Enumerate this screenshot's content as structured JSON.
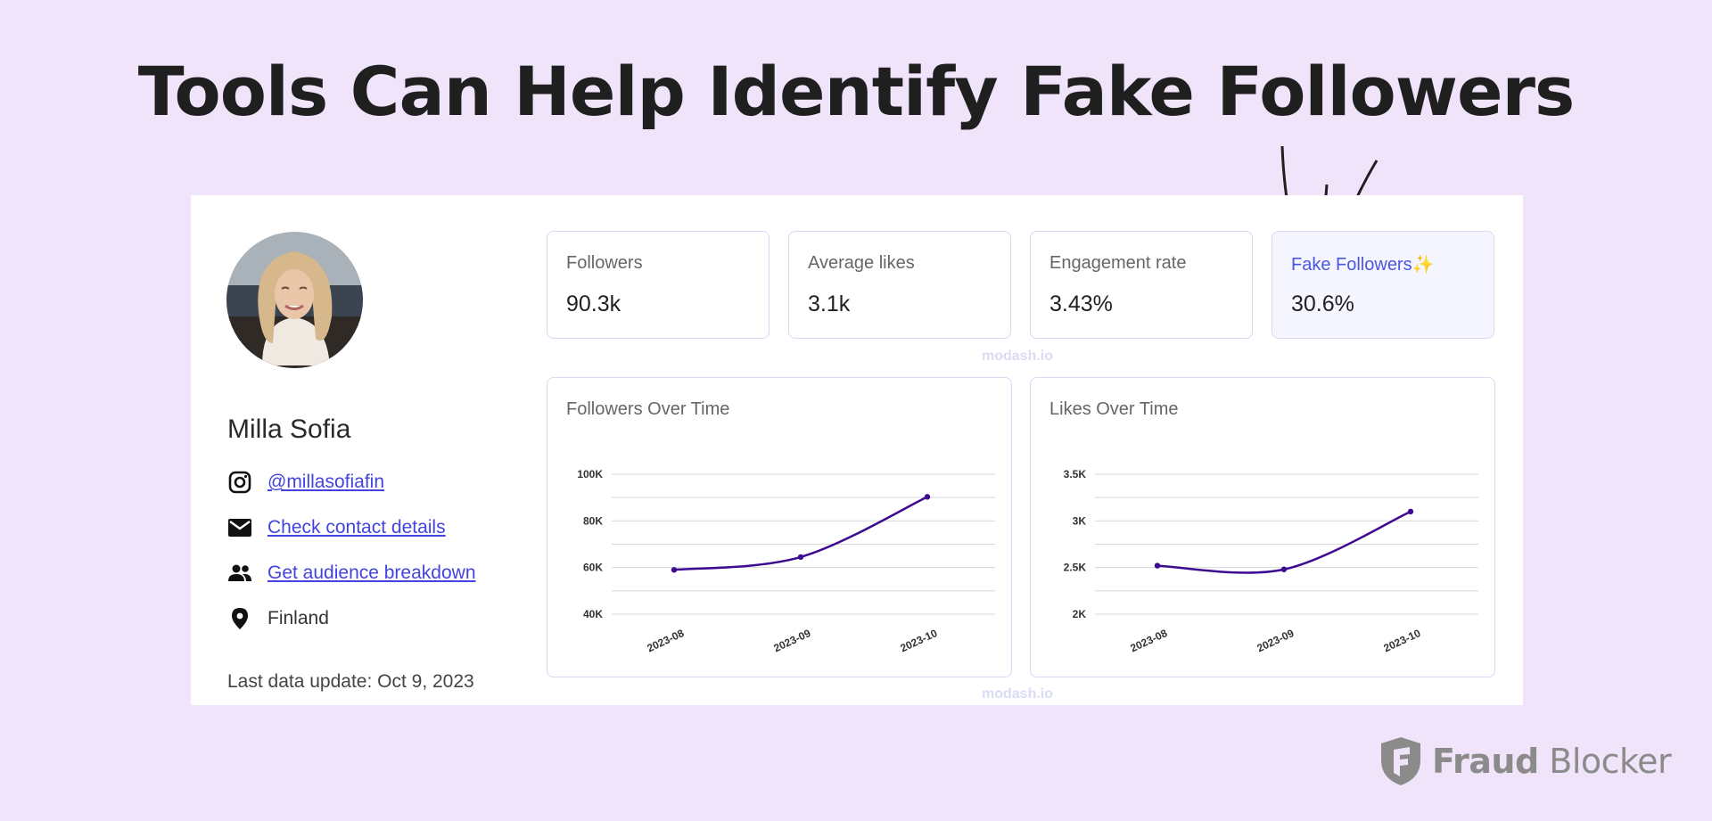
{
  "headline": "Tools Can Help Identify Fake Followers",
  "profile": {
    "name": "Milla Sofia",
    "instagram_handle": "@millasofiafin",
    "contact_link": "Check contact details",
    "audience_link": "Get audience breakdown",
    "location": "Finland",
    "last_update": "Last data update: Oct 9, 2023"
  },
  "stats": [
    {
      "label": "Followers",
      "value": "90.3k"
    },
    {
      "label": "Average likes",
      "value": "3.1k"
    },
    {
      "label": "Engagement rate",
      "value": "3.43%"
    },
    {
      "label": "Fake Followers",
      "value": "30.6%",
      "badge": "✨"
    }
  ],
  "watermark": "modash.io",
  "brand": {
    "word1": "Fraud",
    "word2": " Blocker"
  },
  "colors": {
    "background": "#f0e4fa",
    "accent": "#4343e0",
    "line": "#3d0a91",
    "card_border": "#d9d9f4"
  },
  "icons": [
    "instagram-icon",
    "mail-icon",
    "people-icon",
    "location-pin-icon",
    "shield-f-icon",
    "sparkles-icon"
  ],
  "chart_data": [
    {
      "type": "line",
      "title": "Followers Over Time",
      "categories": [
        "2023-08",
        "2023-09",
        "2023-10"
      ],
      "values": [
        59000,
        64500,
        90300
      ],
      "y_ticks": [
        40000,
        60000,
        80000,
        100000
      ],
      "y_tick_labels": [
        "40K",
        "60K",
        "80K",
        "100K"
      ],
      "ylim": [
        40000,
        100000
      ],
      "grid": true
    },
    {
      "type": "line",
      "title": "Likes Over Time",
      "categories": [
        "2023-08",
        "2023-09",
        "2023-10"
      ],
      "values": [
        2520,
        2480,
        3100
      ],
      "y_ticks": [
        2000,
        2500,
        3000,
        3500
      ],
      "y_tick_labels": [
        "2K",
        "2.5K",
        "3K",
        "3.5K"
      ],
      "ylim": [
        2000,
        3500
      ],
      "grid": true
    }
  ]
}
